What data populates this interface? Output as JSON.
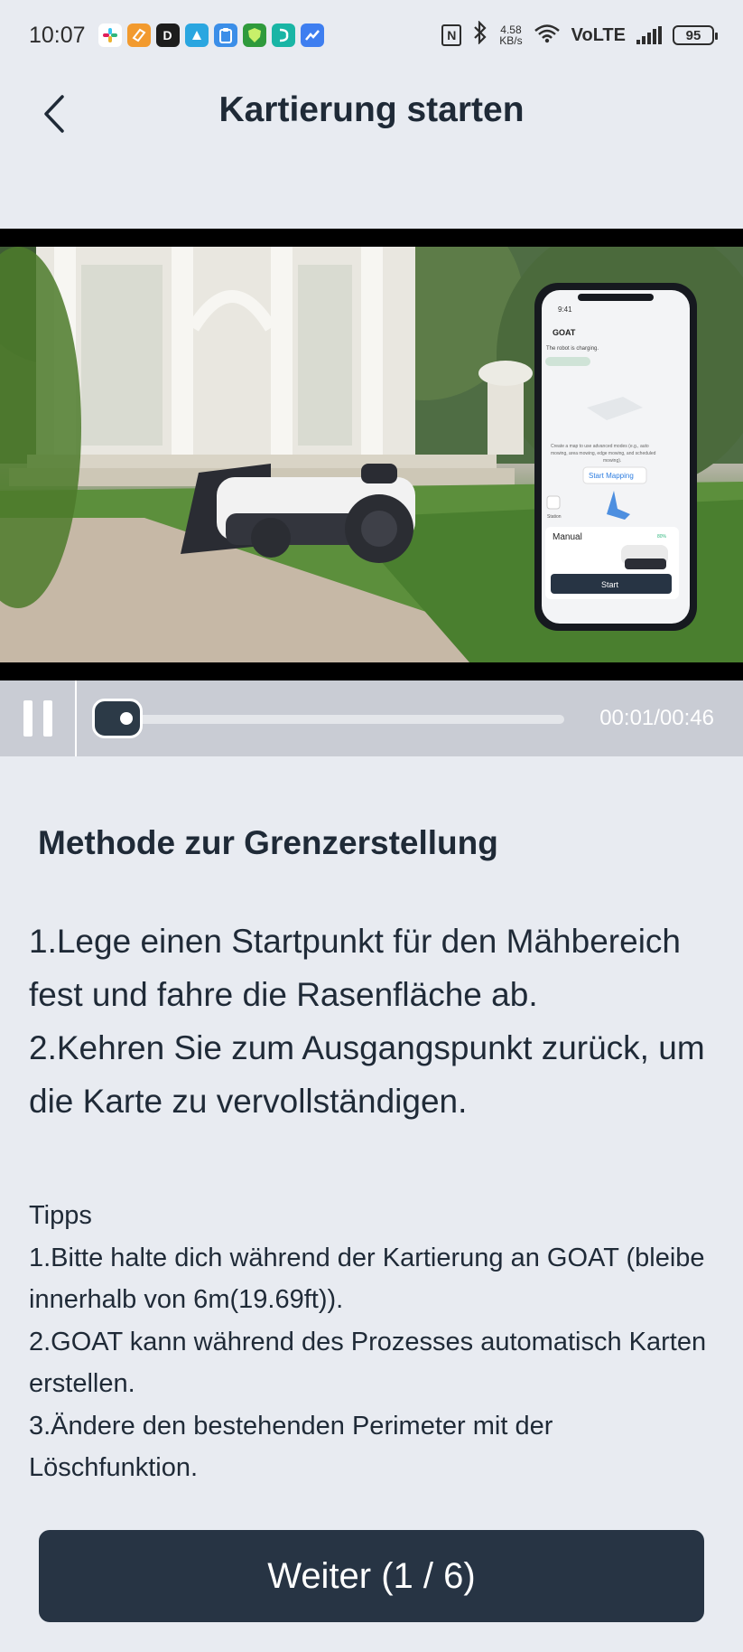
{
  "status_bar": {
    "time": "10:07",
    "network_speed_value": "4.58",
    "network_speed_unit": "KB/s",
    "network_type": "VoLTE",
    "battery": "95",
    "app_icons": [
      "slack-icon",
      "orange-app-icon",
      "d-app-icon",
      "blue-app-icon",
      "clipboard-app-icon",
      "shield-app-icon",
      "teal-app-icon",
      "chart-app-icon"
    ]
  },
  "header": {
    "title": "Kartierung starten"
  },
  "video": {
    "phone_time": "9:41",
    "phone_app_title": "GOAT",
    "phone_status": "The robot is charging.",
    "phone_hint": "Create a map to use advanced modes (e.g., auto mowing, area mowing, edge mowing, and scheduled mowing).",
    "phone_start_mapping": "Start Mapping",
    "phone_station_label": "Station",
    "phone_mode": "Manual",
    "phone_battery": "80%",
    "phone_start_button": "Start",
    "time_readout": "00:01/00:46",
    "progress_fraction": 0.022
  },
  "content": {
    "section_title": "Methode zur Grenzerstellung",
    "steps": [
      "1.Lege einen Startpunkt für den Mähbereich fest und fahre die Rasenfläche ab.",
      "2.Kehren Sie zum Ausgangspunkt zurück, um die Karte zu vervollständigen."
    ],
    "tips_title": "Tipps",
    "tips": [
      "1.Bitte halte dich während der Kartierung an GOAT (bleibe innerhalb von 6m(19.69ft)).",
      "2.GOAT kann während des Prozesses automatisch Karten erstellen.",
      "3.Ändere den bestehenden Perimeter mit der Löschfunktion."
    ]
  },
  "footer": {
    "next_button": "Weiter (1 / 6)"
  },
  "colors": {
    "background": "#e8ebf1",
    "primary_dark": "#273444",
    "text": "#1f2a37",
    "controls_bg": "#c9ccd4"
  }
}
